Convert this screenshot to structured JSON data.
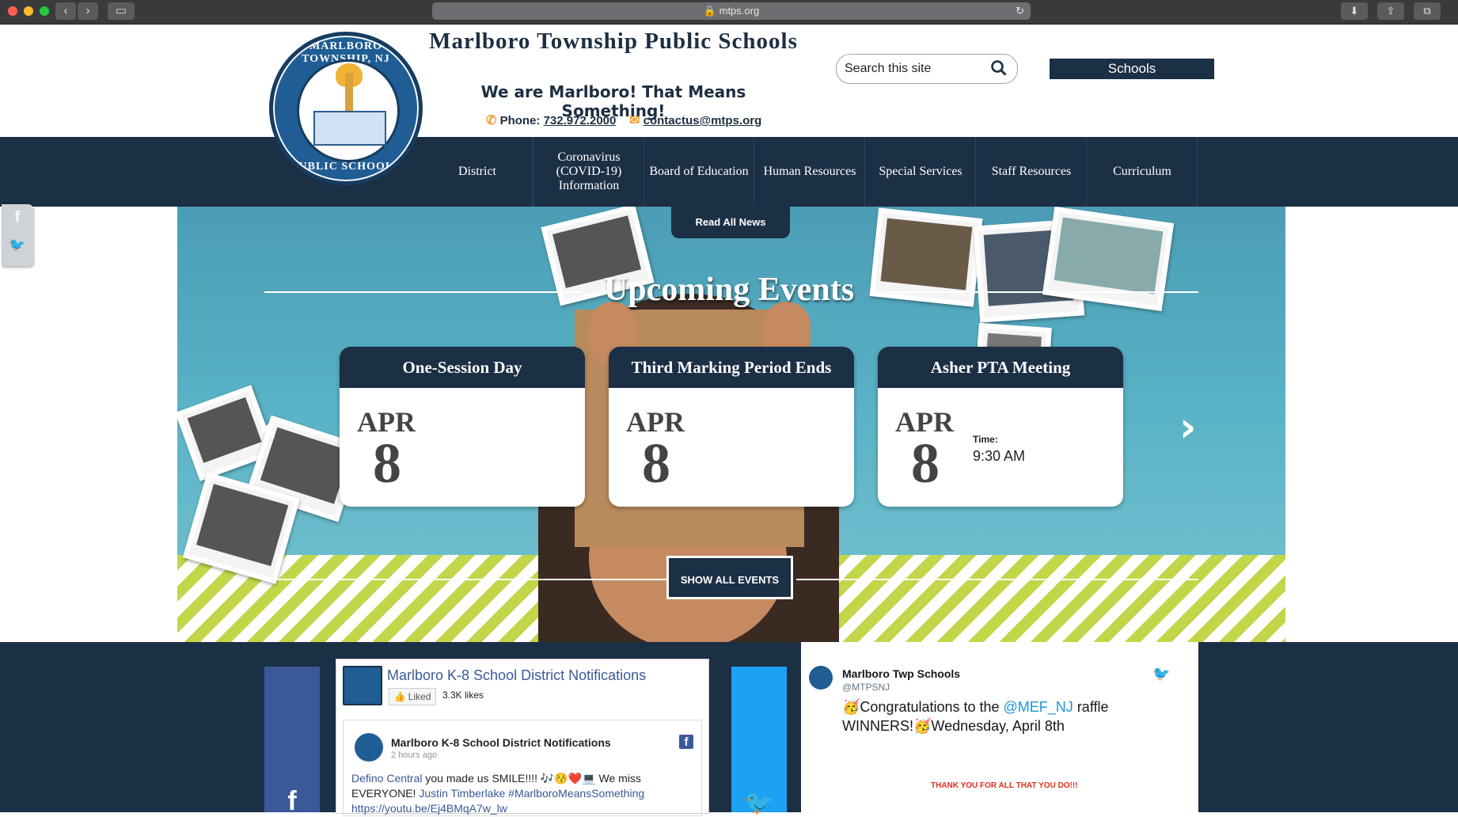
{
  "browser": {
    "url": "mtps.org",
    "back_icon": "chevron-left-icon",
    "forward_icon": "chevron-right-icon",
    "sidebar_icon": "sidebar-icon",
    "reload_icon": "reload-icon",
    "download_icon": "download-icon",
    "share_icon": "share-icon",
    "tabs_icon": "tabs-icon"
  },
  "header": {
    "logo_text_top": "MARLBORO TOWNSHIP, NJ",
    "logo_text_bottom": "PUBLIC SCHOOLS",
    "site_title": "Marlboro Township Public Schools",
    "tagline": "We are Marlboro! That Means Something!",
    "phone_label": "Phone:",
    "phone": "732.972.2000",
    "email": "contactus@mtps.org",
    "search_placeholder": "Search this site",
    "schools_button": "Schools"
  },
  "nav": {
    "items": [
      "District",
      "Coronavirus (COVID-19) Information",
      "Board of Education",
      "Human Resources",
      "Special Services",
      "Staff Resources",
      "Curriculum"
    ]
  },
  "hero": {
    "read_all_news": "Read All News",
    "section_title": "Upcoming Events",
    "events": [
      {
        "title": "One-Session Day",
        "month": "APR",
        "day": "8",
        "time_label": "",
        "time": ""
      },
      {
        "title": "Third Marking Period Ends",
        "month": "APR",
        "day": "8",
        "time_label": "",
        "time": ""
      },
      {
        "title": "Asher PTA Meeting",
        "month": "APR",
        "day": "8",
        "time_label": "Time:",
        "time": "9:30 AM"
      }
    ],
    "prev_arrow": "‹",
    "next_arrow": "›",
    "show_all_events": "SHOW ALL EVENTS"
  },
  "facebook": {
    "page_title": "Marlboro K-8 School District Notifications",
    "liked_button": "Liked",
    "likes_count": "3.3K likes",
    "post_author": "Marlboro K-8 School District Notifications",
    "post_time": "2 hours ago",
    "post_link1": "Defino Central",
    "post_text1": " you made us SMILE!!!! 🎶😚❤️💻 We miss EVERYONE! ",
    "post_link2": "Justin Timberlake",
    "post_tag": "#MarlboroMeansSomething",
    "post_url": "https://youtu.be/Ej4BMqA7w_lw"
  },
  "twitter": {
    "name": "Marlboro Twp Schools",
    "handle": "@MTPSNJ",
    "text1": "🥳Congratulations to the ",
    "mention": "@MEF_NJ",
    "text2": " raffle WINNERS!🥳Wednesday, April 8th",
    "image_caption": "THANK YOU FOR ALL THAT YOU DO!!!"
  },
  "colors": {
    "navy": "#1b2f45",
    "accent_orange": "#f29a2e",
    "facebook_blue": "#3b5998",
    "twitter_blue": "#1da1f2"
  }
}
